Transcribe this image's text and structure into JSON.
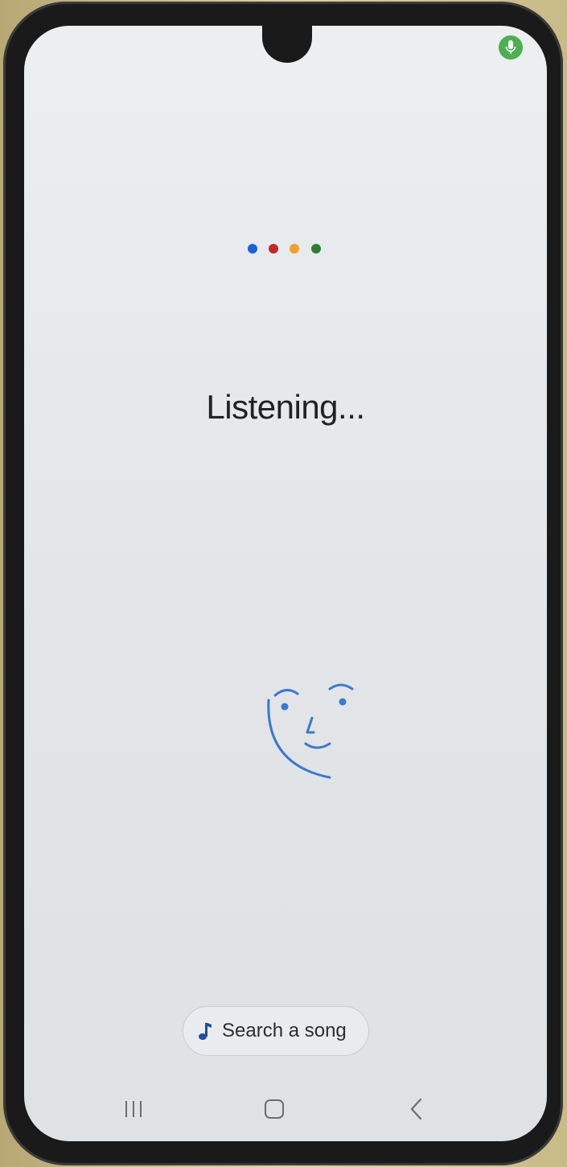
{
  "status": {
    "listening_text": "Listening..."
  },
  "indicator": {
    "dot_colors": [
      "#1a62d6",
      "#c62828",
      "#f0a030",
      "#2e7d32"
    ],
    "mic_color": "#4caf50"
  },
  "actions": {
    "search_song_label": "Search a song",
    "search_song_icon": "music-note-icon"
  },
  "navigation": {
    "recents_icon": "recents-icon",
    "home_icon": "home-icon",
    "back_icon": "back-icon"
  }
}
